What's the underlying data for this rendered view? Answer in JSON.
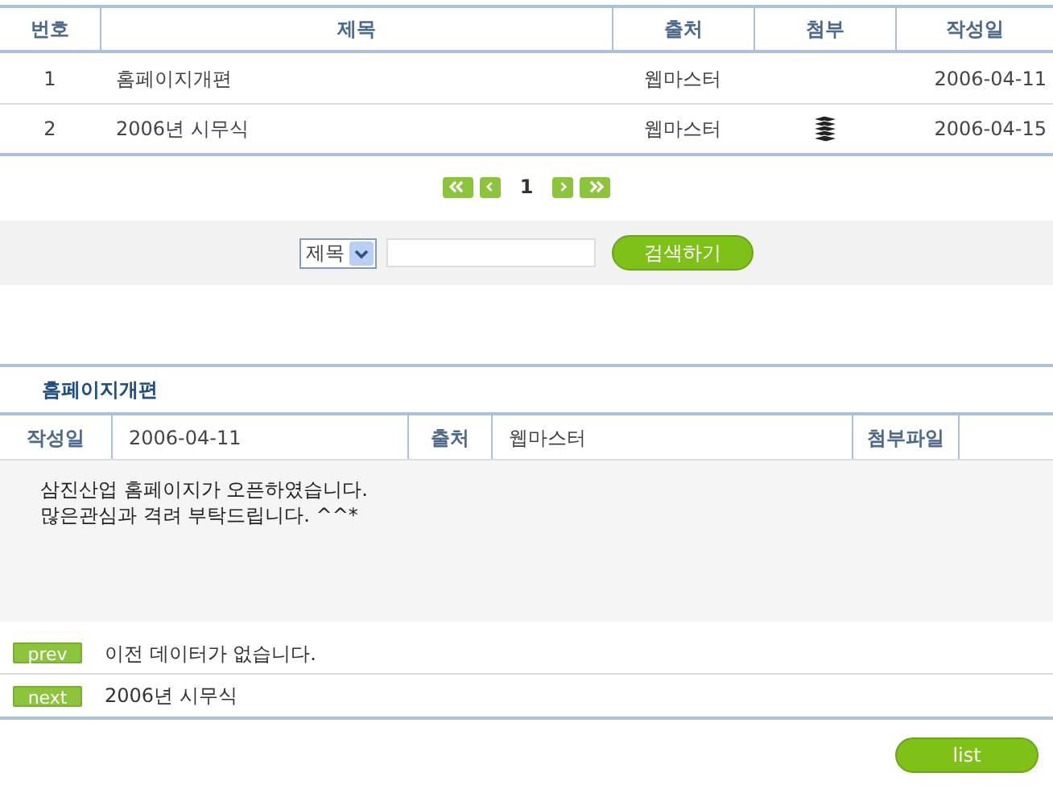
{
  "table": {
    "columns": [
      "번호",
      "제목",
      "출처",
      "첨부",
      "작성일"
    ],
    "rows": [
      {
        "number": "1",
        "title": "홈페이지개편",
        "source": "웹마스터",
        "attachment": false,
        "date": "2006-04-11"
      },
      {
        "number": "2",
        "title": "2006년 시무식",
        "source": "웹마스터",
        "attachment": true,
        "date": "2006-04-15"
      }
    ]
  },
  "pagination": {
    "pages": [
      {
        "label": "1",
        "selected": true
      }
    ]
  },
  "search": {
    "field_select": "제목",
    "button": "검색하기"
  },
  "article": {
    "title": "홈페이지개편",
    "date_label": "작성일",
    "date": "2006-04-11",
    "source_label": "출처",
    "source": "웹마스터",
    "attachment_label": "첨부파일",
    "body": [
      "삼진산업 홈페이지가 오픈하였습니다.",
      "많은관심과 격려 부탁드립니다. ^^*"
    ]
  },
  "navigation": [
    {
      "button": "prev",
      "text": "이전 데이터가 없습니다."
    },
    {
      "button": "next",
      "text": "2006년 시무식"
    }
  ],
  "list_button": "list"
}
